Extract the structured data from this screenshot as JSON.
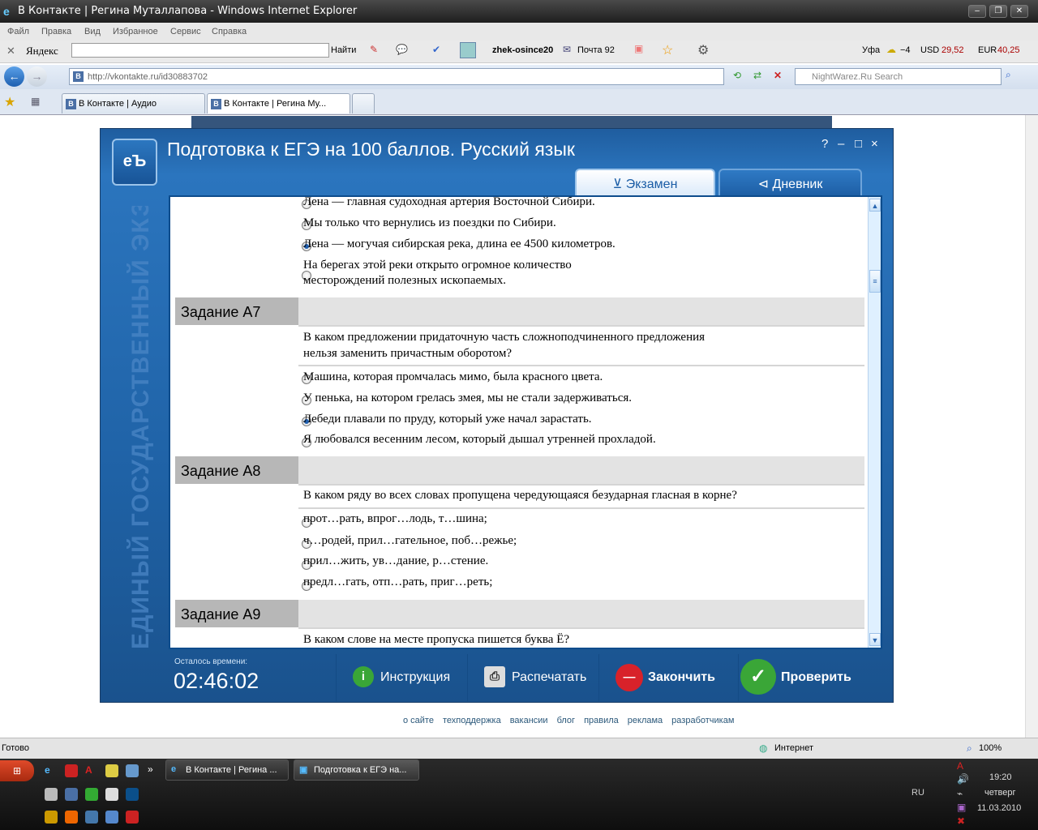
{
  "browser": {
    "title": "В Контакте | Регина Муталлапова - Windows Internet Explorer",
    "menu": [
      "Файл",
      "Правка",
      "Вид",
      "Избранное",
      "Сервис",
      "Справка"
    ],
    "toolbar": {
      "yandex": "Яндекс",
      "find": "Найти",
      "login": "zhek-osince20",
      "mail": "Почта 92",
      "city": "Уфа",
      "weather": "−4",
      "usd_label": "USD",
      "usd_value": "29,52",
      "eur_label": "EUR",
      "eur_value": "40,25"
    },
    "address": {
      "url": "http://vkontakte.ru/id30883702",
      "search_placeholder": "NightWarez.Ru Search"
    },
    "tabs": [
      {
        "label": "В Контакте | Аудио"
      },
      {
        "label": "В Контакте | Регина Му..."
      }
    ],
    "status": {
      "left": "Готово",
      "zone": "Интернет",
      "zoom": "100%"
    }
  },
  "app": {
    "title": "Подготовка к ЕГЭ на 100 баллов. Русский язык",
    "controls": {
      "help": "?",
      "minimize": "–",
      "maximize": "□",
      "close": "×"
    },
    "tabs": {
      "exam": "Экзамен",
      "diary": "Дневник"
    },
    "side_text": "ЕДИНЫЙ ГОСУДАРСТВЕННЫЙ ЭКЗАМЕН",
    "logo": "еЪ",
    "prev_options": [
      {
        "text": "Лена — главная судоходная артерия Восточной Сибири.",
        "selected": false
      },
      {
        "text": "Мы только что вернулись из поездки по Сибири.",
        "selected": false
      },
      {
        "text": "Лена — могучая сибирская река, длина ее 4500 километров.",
        "selected": true
      },
      {
        "text": "На берегах этой реки открыто огромное количество",
        "text2": "месторождений полезных ископаемых.",
        "selected": false
      }
    ],
    "a7": {
      "label": "Задание А7",
      "q1": "В каком предложении придаточную часть сложноподчиненного предложения",
      "q2": "нельзя заменить причастным оборотом?",
      "options": [
        {
          "text": "Машина, которая промчалась мимо, была красного цвета.",
          "selected": false
        },
        {
          "text": "У пенька, на котором грелась змея, мы не стали задерживаться.",
          "selected": false
        },
        {
          "text": "Лебеди плавали по пруду, который уже начал зарастать.",
          "selected": true
        },
        {
          "text": "Я любовался весенним лесом, который дышал утренней прохладой.",
          "selected": false
        }
      ]
    },
    "a8": {
      "label": "Задание А8",
      "q": "В каком ряду во всех словах пропущена чередующаяся безударная гласная в корне?",
      "options": [
        {
          "text": "прот…рать, впрог…лодь, т…шина;",
          "selected": false
        },
        {
          "text": "ч…родей, прил…гательное, поб…режье;",
          "selected": false
        },
        {
          "text": "прил…жить, ув…дание, р…стение.",
          "selected": false
        },
        {
          "text": "предл…гать, отп…рать, приг…реть;",
          "selected": false
        }
      ]
    },
    "a9": {
      "label": "Задание А9",
      "q": "В каком слове на месте пропуска пишется буква Ё?"
    },
    "timer": {
      "label": "Осталось времени:",
      "value": "02:46:02"
    },
    "buttons": {
      "instruction": "Инструкция",
      "print": "Распечатать",
      "finish": "Закончить",
      "check": "Проверить"
    }
  },
  "footer": [
    "о сайте",
    "техподдержка",
    "вакансии",
    "блог",
    "правила",
    "реклама",
    "разработчикам"
  ],
  "taskbar": {
    "items": [
      "В Контакте | Регина ...",
      "Подготовка к ЕГЭ на..."
    ],
    "lang": "RU",
    "time": "19:20",
    "day": "четверг",
    "date": "11.03.2010"
  },
  "colors": {
    "app_blue": "#2566a8",
    "selected_radio": "#1f5fb0",
    "finish_red": "#d8222a",
    "check_green": "#3aa637"
  }
}
